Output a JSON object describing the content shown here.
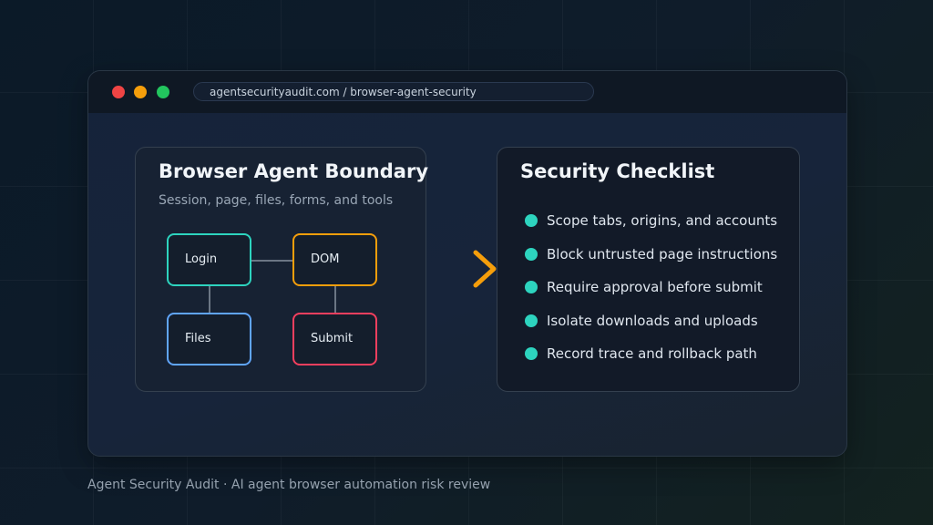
{
  "browser": {
    "url": "agentsecurityaudit.com / browser-agent-security"
  },
  "boundary_panel": {
    "title": "Browser Agent Boundary",
    "subtitle": "Session, page, files, forms, and tools",
    "nodes": {
      "login": "Login",
      "dom": "DOM",
      "files": "Files",
      "submit": "Submit"
    }
  },
  "checklist_panel": {
    "title": "Security Checklist",
    "items": [
      "Scope tabs, origins, and accounts",
      "Block untrusted page instructions",
      "Require approval before submit",
      "Isolate downloads and uploads",
      "Record trace and rollback path"
    ]
  },
  "footer": {
    "text": "Agent Security Audit · AI agent browser automation risk review"
  },
  "icons": {
    "arrow": "chevron-right-icon",
    "bullet": "check-bullet-dot"
  },
  "colors": {
    "teal": "#2dd4bf",
    "amber": "#f59e0b",
    "blue": "#60a5fa",
    "rose": "#f43f5e",
    "window_red": "#ef4444",
    "window_yellow": "#f59e0b",
    "window_green": "#22c55e",
    "bullet": "#2dd4bf"
  }
}
